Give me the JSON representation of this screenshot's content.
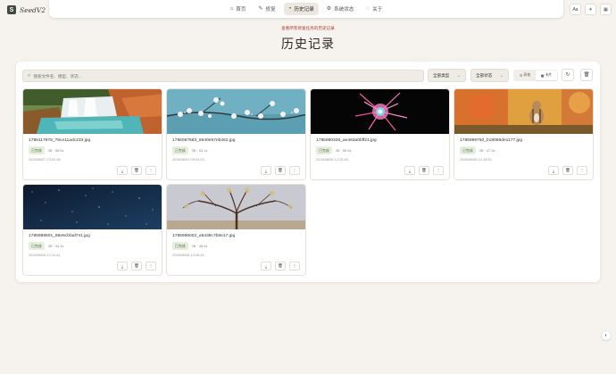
{
  "app": {
    "logo_letter": "S",
    "name": "SeedV2"
  },
  "nav": {
    "items": [
      {
        "icon": "⌂",
        "label": "首页"
      },
      {
        "icon": "✎",
        "label": "修复"
      },
      {
        "icon": "◔",
        "label": "历史记录"
      },
      {
        "icon": "⚙",
        "label": "系统状态"
      },
      {
        "icon": "◌",
        "label": "关于"
      }
    ],
    "active_index": 2
  },
  "toolbar": {
    "font_label": "Aa",
    "theme_icon": "☀",
    "grid_icon": "▦"
  },
  "header": {
    "subtitle": "查看所有修复任务的历史记录",
    "title": "历史记录"
  },
  "filters": {
    "search_placeholder": "搜索文件名、模型、状态...",
    "type_select": "全部类型",
    "status_select": "全部状态",
    "view_grid_label": "卡片",
    "view_list_label": "表格",
    "refresh_icon": "↻",
    "delete_icon": "🗑"
  },
  "cards": [
    {
      "filename": "1786117978_78ce11adc233.jpg",
      "status": "已完成",
      "meta": "3B · 58.5s",
      "time": "2026/06/07 23:52:56"
    },
    {
      "filename": "1786067583_6640e57eb462.jpg",
      "status": "已完成",
      "meta": "3B · 63.1s",
      "time": "2026/06/07 09:53:03"
    },
    {
      "filename": "1785990326_ae463a0bff21.jpg",
      "status": "已完成",
      "meta": "3B · 56.5s",
      "time": "2026/06/06 12:25:26"
    },
    {
      "filename": "1785989750_b19068de1177.jpg",
      "status": "已完成",
      "meta": "3B · 47.3s",
      "time": "2026/06/06 12:15:50"
    },
    {
      "filename": "1785989501_86e6cbfad741.jpg",
      "status": "已完成",
      "meta": "3B · 44.4s",
      "time": "2026/06/06 12:11:41"
    },
    {
      "filename": "1785985002_a5439c7b9e17.jpg",
      "status": "已完成",
      "meta": "3B · 48.0s",
      "time": "2026/06/06 10:56:42"
    }
  ],
  "card_actions": {
    "download_icon": "⤓",
    "delete_icon": "🗑",
    "more_icon": "⋮"
  },
  "float": {
    "icon": "◐"
  }
}
